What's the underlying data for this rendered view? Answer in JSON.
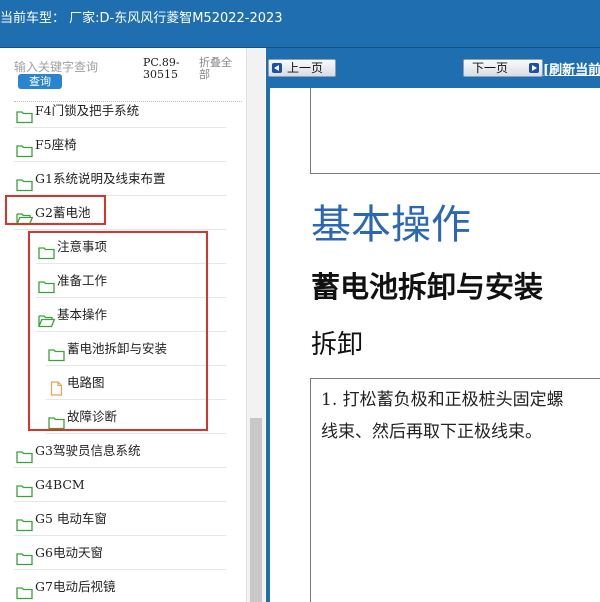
{
  "header": {
    "vehicle_info": "当前车型：  厂家:D-东风风行菱智M52022-2023"
  },
  "search": {
    "placeholder": "输入关键字查询",
    "button_label": "查询",
    "doc_code": "PC.89-30515",
    "collapse_all": "折叠全部"
  },
  "tree": {
    "items": [
      {
        "label": "F4门锁及把手系统",
        "icon": "folder-closed-icon"
      },
      {
        "label": "F5座椅",
        "icon": "folder-closed-icon"
      },
      {
        "label": "G1系统说明及线束布置",
        "icon": "folder-closed-icon"
      },
      {
        "label": "G2蓄电池",
        "icon": "folder-open-icon"
      },
      {
        "label": "注意事项",
        "icon": "folder-closed-icon"
      },
      {
        "label": "准备工作",
        "icon": "folder-closed-icon"
      },
      {
        "label": "基本操作",
        "icon": "folder-open-icon"
      },
      {
        "label": "蓄电池拆卸与安装",
        "icon": "folder-closed-icon"
      },
      {
        "label": "电路图",
        "icon": "document-icon"
      },
      {
        "label": "故障诊断",
        "icon": "folder-closed-icon"
      },
      {
        "label": "G3驾驶员信息系统",
        "icon": "folder-closed-icon"
      },
      {
        "label": "G4BCM",
        "icon": "folder-closed-icon"
      },
      {
        "label": "G5 电动车窗",
        "icon": "folder-closed-icon"
      },
      {
        "label": "G6电动天窗",
        "icon": "folder-closed-icon"
      },
      {
        "label": "G7电动后视镜",
        "icon": "folder-closed-icon"
      }
    ]
  },
  "viewer": {
    "prev_label": "上一页",
    "next_label": "下一页",
    "refresh_label": "[刷新当前"
  },
  "document": {
    "heading1": "基本操作",
    "heading2": "蓄电池拆卸与安装",
    "heading3": "拆卸",
    "step1_line1": "1. 打松蓄负极和正极桩头固定螺",
    "step1_line2": "线束、然后再取下正极线束。"
  },
  "colors": {
    "toolbar_blue": "#1f6fb0",
    "heading_blue": "#2b67b6",
    "folder_green": "#3aa23a",
    "highlight_red": "#d9342b"
  }
}
